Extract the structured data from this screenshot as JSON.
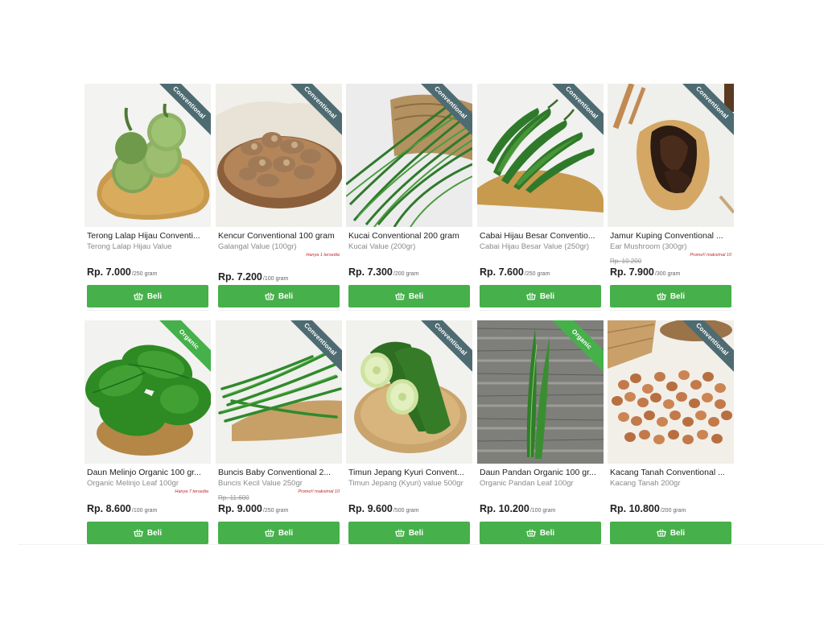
{
  "buy_label": "Beli",
  "products": [
    {
      "tag": "Conventional",
      "name": "Terong Lalap Hijau Conventi...",
      "variant": "Terong Lalap Hijau Value",
      "note": "",
      "old_price": "",
      "price": "Rp. 7.000",
      "unit": "/250 gram"
    },
    {
      "tag": "Conventional",
      "name": "Kencur Conventional 100 gram",
      "variant": "Galangal Value (100gr)",
      "note": "Hanya 1 tersedia",
      "old_price": "",
      "price": "Rp. 7.200",
      "unit": "/100 gram"
    },
    {
      "tag": "Conventional",
      "name": "Kucai Conventional 200 gram",
      "variant": "Kucai Value (200gr)",
      "note": "",
      "old_price": "",
      "price": "Rp. 7.300",
      "unit": "/200 gram"
    },
    {
      "tag": "Conventional",
      "name": "Cabai Hijau Besar Conventio...",
      "variant": "Cabai Hijau Besar Value (250gr)",
      "note": "",
      "old_price": "",
      "price": "Rp. 7.600",
      "unit": "/250 gram"
    },
    {
      "tag": "Conventional",
      "name": "Jamur Kuping Conventional ...",
      "variant": "Ear Mushroom (300gr)",
      "note": "Promo!! maksimal 10",
      "old_price": "Rp. 10.200",
      "price": "Rp. 7.900",
      "unit": "/300 gram"
    },
    {
      "tag": "Organic",
      "name": "Daun Melinjo Organic 100 gr...",
      "variant": "Organic Melinjo Leaf 100gr",
      "note": "Hanya 7 tersedia",
      "old_price": "",
      "price": "Rp. 8.600",
      "unit": "/100 gram"
    },
    {
      "tag": "Conventional",
      "name": "Buncis Baby Conventional 2...",
      "variant": "Buncis Kecil Value 250gr",
      "note": "Promo!! maksimal 10",
      "old_price": "Rp. 11.600",
      "price": "Rp. 9.000",
      "unit": "/250 gram"
    },
    {
      "tag": "Conventional",
      "name": "Timun Jepang Kyuri Convent...",
      "variant": "Timun Jepang (Kyuri) value 500gr",
      "note": "",
      "old_price": "",
      "price": "Rp. 9.600",
      "unit": "/500 gram"
    },
    {
      "tag": "Organic",
      "name": "Daun Pandan Organic 100 gr...",
      "variant": "Organic Pandan Leaf 100gr",
      "note": "",
      "old_price": "",
      "price": "Rp. 10.200",
      "unit": "/100 gram"
    },
    {
      "tag": "Conventional",
      "name": "Kacang Tanah Conventional ...",
      "variant": "Kacang Tanah 200gr",
      "note": "",
      "old_price": "",
      "price": "Rp. 10.800",
      "unit": "/200 gram"
    }
  ]
}
